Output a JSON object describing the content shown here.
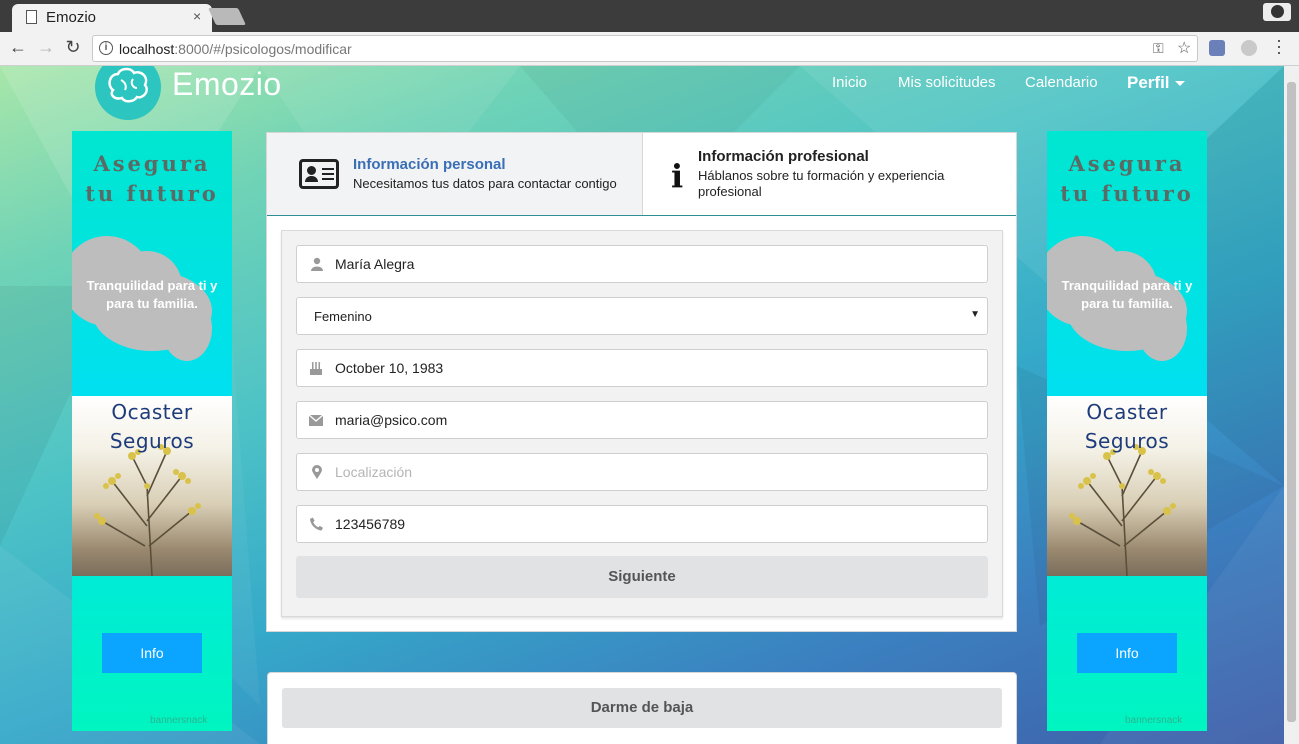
{
  "browser": {
    "tab_title": "Emozio",
    "tab_close": "×",
    "url_host": "localhost",
    "url_rest": ":8000/#/psicologos/modificar"
  },
  "navbar": {
    "brand": "Emozio",
    "links": [
      "Inicio",
      "Mis solicitudes",
      "Calendario"
    ],
    "perfil": "Perfil"
  },
  "banner": {
    "title_line1": "Asegura",
    "title_line2": "tu futuro",
    "tagline_line1": "Tranquilidad para ti y",
    "tagline_line2": "para tu familia.",
    "company_line1": "Ocaster",
    "company_line2": "Seguros",
    "info_button": "Info",
    "credit": "bannersnack"
  },
  "wizard": {
    "step1": {
      "title": "Información personal",
      "subtitle": "Necesitamos tus datos para contactar contigo",
      "title_color": "#3a6fb5"
    },
    "step2": {
      "icon": "i",
      "title": "Información profesional",
      "subtitle_line1": "Háblanos sobre tu formación y experiencia",
      "subtitle_line2": "profesional"
    }
  },
  "form": {
    "name": {
      "value": "María Alegra",
      "icon": "user-icon"
    },
    "gender": {
      "value": "Femenino",
      "icon": "chevron-down-icon"
    },
    "birthdate": {
      "value": "October 10, 1983",
      "icon": "birthday-cake-icon"
    },
    "email": {
      "value": "maria@psico.com",
      "icon": "envelope-icon"
    },
    "location": {
      "value": "",
      "placeholder": "Localización",
      "icon": "map-marker-icon"
    },
    "phone": {
      "value": "123456789",
      "icon": "phone-icon"
    },
    "next_button": "Siguiente"
  },
  "unsubscribe_button": "Darme de baja",
  "colors": {
    "accent_blue": "#3a6fb5",
    "banner_button": "#0ba5ff",
    "step_border": "#2e8f94"
  }
}
